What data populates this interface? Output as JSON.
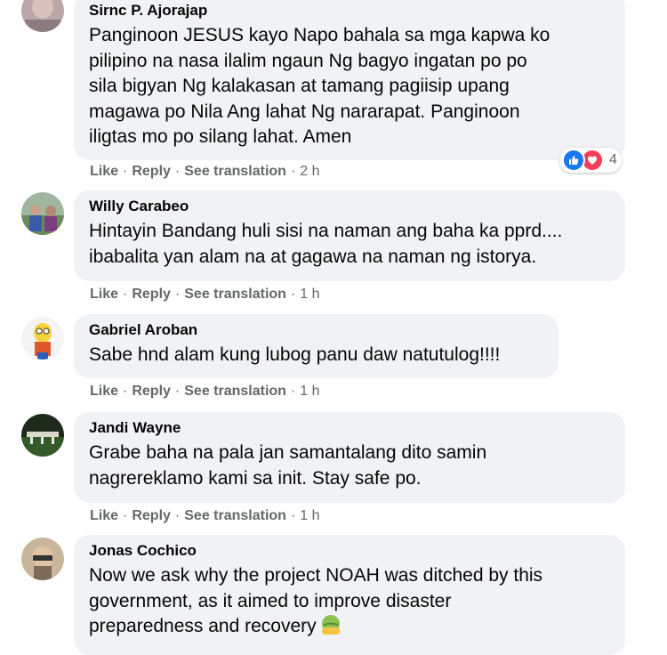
{
  "actions": {
    "like": "Like",
    "reply": "Reply",
    "see_translation": "See translation",
    "sep": "·"
  },
  "comments": [
    {
      "name": "Sirnc P. Ajorajap",
      "text": "Panginoon JESUS kayo Napo bahala sa mga kapwa ko\npilipino na nasa ilalim ngaun Ng bagyo ingatan po po\nsila bigyan Ng kalakasan at tamang pagiisip upang\nmagawa po Nila Ang lahat Ng nararapat. Panginoon\niligtas mo po silang lahat. Amen",
      "time": "2 h",
      "reaction_count": "4"
    },
    {
      "name": "Willy Carabeo",
      "text": "Hintayin Bandang huli sisi na naman ang baha ka pprd....\nibabalita yan alam na at gagawa na naman ng istorya.",
      "time": "1 h"
    },
    {
      "name": "Gabriel Aroban",
      "text": "Sabe hnd alam kung lubog panu daw natutulog!!!!",
      "time": "1 h"
    },
    {
      "name": "Jandi Wayne",
      "text": "Grabe baha na pala jan samantalang dito samin\nnagrereklamo kami sa init. Stay safe po.",
      "time": "1 h"
    },
    {
      "name": "Jonas Cochico",
      "text": "Now we ask why the project NOAH was ditched by this\ngovernment, as it aimed to improve disaster\npreparedness and recovery"
    }
  ],
  "colors": {
    "bubble": "#f0f2f5",
    "meta": "#65676b",
    "like": "#1877f2",
    "love": "#f33e58"
  }
}
